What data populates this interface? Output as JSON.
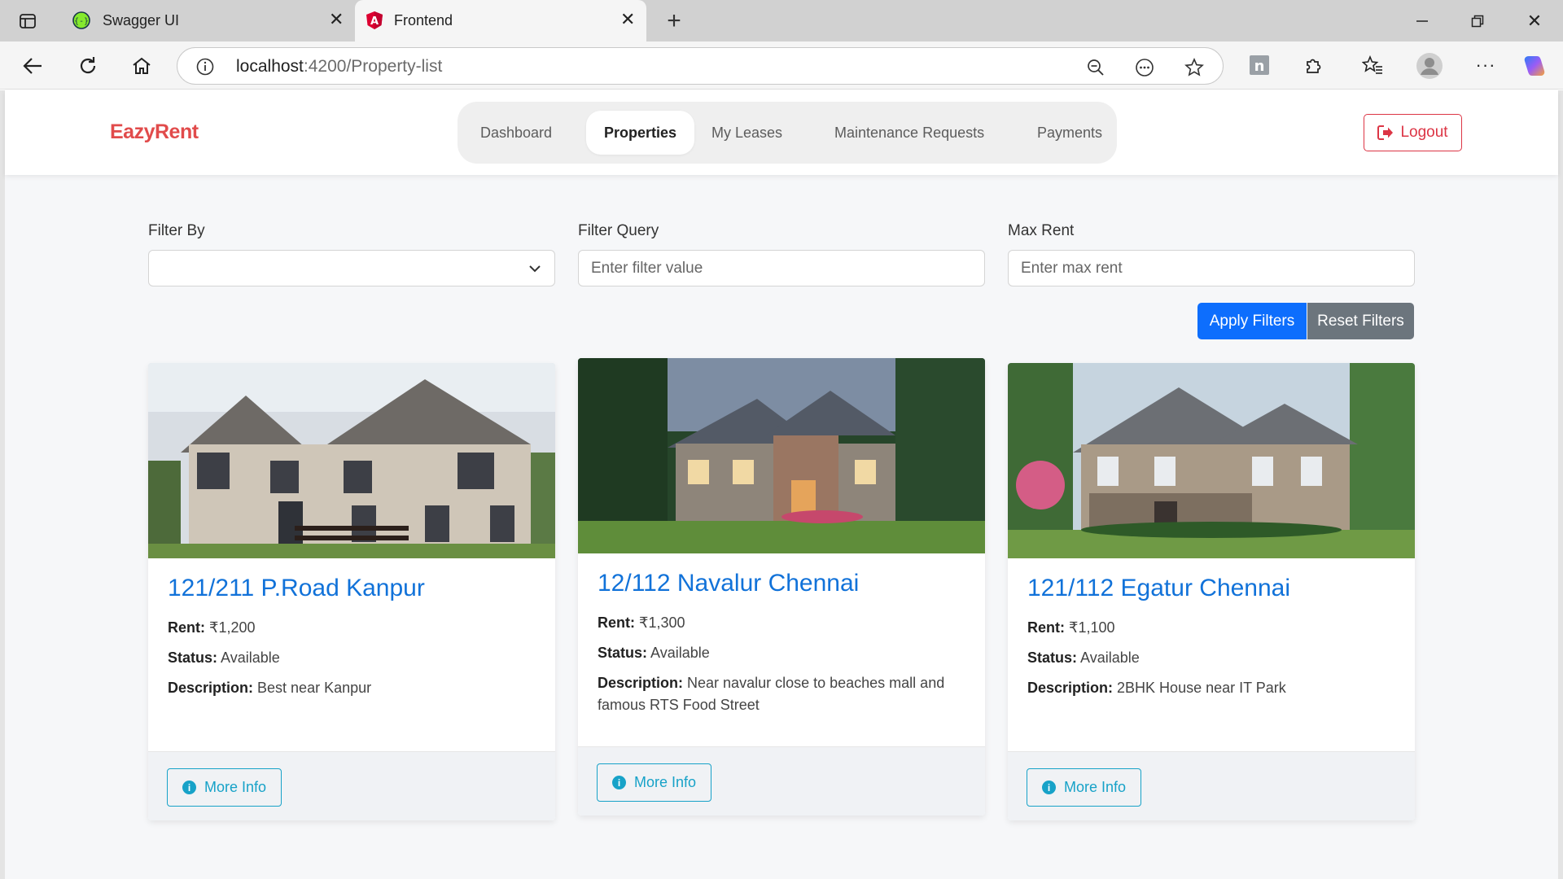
{
  "browser": {
    "tabs": [
      {
        "label": "Swagger UI",
        "icon": "swagger-icon"
      },
      {
        "label": "Frontend",
        "icon": "angular-icon"
      }
    ],
    "url_host": "localhost",
    "url_path": ":4200/Property-list"
  },
  "app": {
    "brand": "EazyRent",
    "nav": [
      {
        "label": "Dashboard",
        "active": false
      },
      {
        "label": "Properties",
        "active": true
      },
      {
        "label": "My Leases",
        "active": false
      },
      {
        "label": "Maintenance Requests",
        "active": false
      },
      {
        "label": "Payments",
        "active": false
      }
    ],
    "logout_label": "Logout"
  },
  "filters": {
    "filter_by_label": "Filter By",
    "filter_by_value": "",
    "filter_query_label": "Filter Query",
    "filter_query_placeholder": "Enter filter value",
    "max_rent_label": "Max Rent",
    "max_rent_placeholder": "Enter max rent",
    "apply_label": "Apply Filters",
    "reset_label": "Reset Filters"
  },
  "labels": {
    "rent": "Rent:",
    "status": "Status:",
    "description": "Description:",
    "more_info": "More Info"
  },
  "properties": [
    {
      "title": "121/211 P.Road Kanpur",
      "rent": "₹1,200",
      "status": "Available",
      "description": "Best near Kanpur"
    },
    {
      "title": "12/112 Navalur Chennai",
      "rent": "₹1,300",
      "status": "Available",
      "description": "Near navalur close to beaches mall and famous RTS Food Street"
    },
    {
      "title": "121/112 Egatur Chennai",
      "rent": "₹1,100",
      "status": "Available",
      "description": "2BHK House near IT Park"
    }
  ],
  "colors": {
    "brand": "#e14b4b",
    "primary": "#0d6efd",
    "secondary": "#6c757d",
    "danger": "#dc3545",
    "info": "#17a2c8",
    "title_link": "#1172d9"
  }
}
